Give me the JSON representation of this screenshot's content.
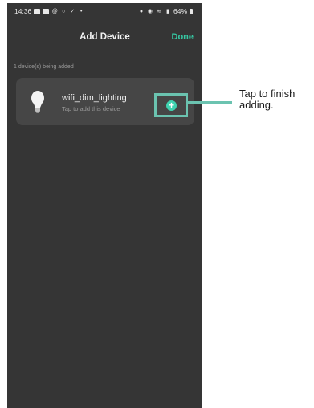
{
  "status_bar": {
    "time": "14:36",
    "battery": "64%"
  },
  "header": {
    "title": "Add Device",
    "done_label": "Done"
  },
  "section": {
    "label": "1 device(s) being added"
  },
  "device": {
    "name": "wifi_dim_lighting",
    "subtitle": "Tap to add this device",
    "icon": "bulb-icon"
  },
  "add_button": {
    "symbol": "+"
  },
  "callout": {
    "text": "Tap to finish adding."
  },
  "colors": {
    "background": "#353535",
    "card": "#464646",
    "accent": "#36c9a4",
    "highlight": "#6bc3b0"
  }
}
